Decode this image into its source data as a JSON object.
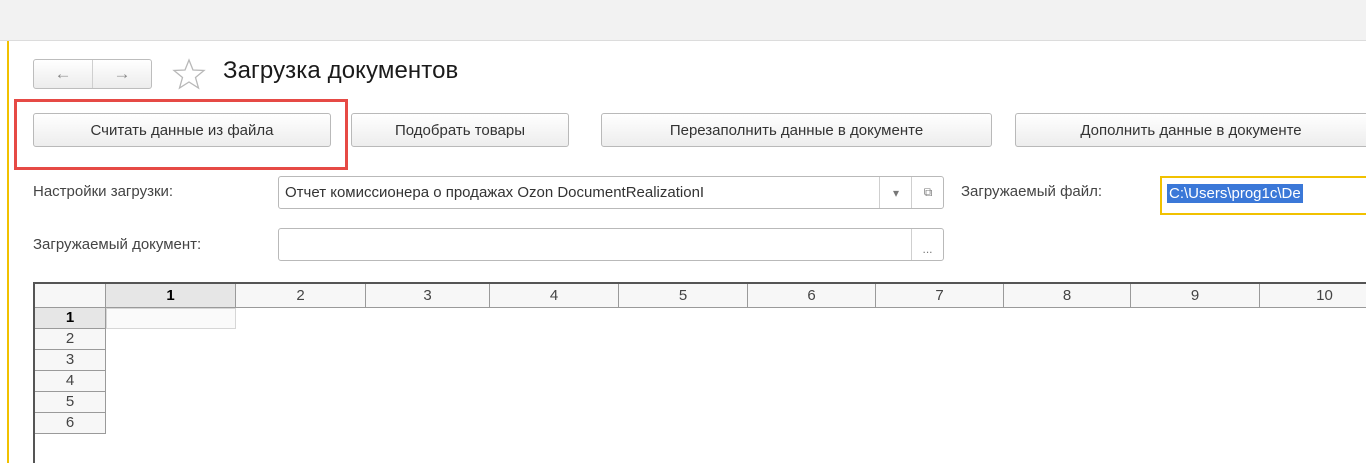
{
  "header": {
    "back_icon": "arrow-left-icon",
    "forward_icon": "arrow-right-icon",
    "favorite_icon": "star-outline-icon",
    "title": "Загрузка документов"
  },
  "toolbar": {
    "read_file_label": "Считать данные из файла",
    "select_goods_label": "Подобрать товары",
    "refill_label": "Перезаполнить данные в документе",
    "append_label": "Дополнить данные в документе"
  },
  "form": {
    "settings_label": "Настройки загрузки:",
    "settings_value": "Отчет комиссионера о продажах Ozon DocumentRealizationI",
    "settings_dropdown_icon": "▾",
    "settings_open_icon": "⧉",
    "file_label": "Загружаемый файл:",
    "file_value": "C:\\Users\\prog1c\\De",
    "document_label": "Загружаемый документ:",
    "document_value": "",
    "document_select_icon": "..."
  },
  "sheet": {
    "columns": [
      "1",
      "2",
      "3",
      "4",
      "5",
      "6",
      "7",
      "8",
      "9",
      "10"
    ],
    "rows": [
      "1",
      "2",
      "3",
      "4",
      "5",
      "6"
    ]
  },
  "colors": {
    "highlight": "#e64a45",
    "accent": "#f1c100",
    "selection": "#3b78d8"
  }
}
